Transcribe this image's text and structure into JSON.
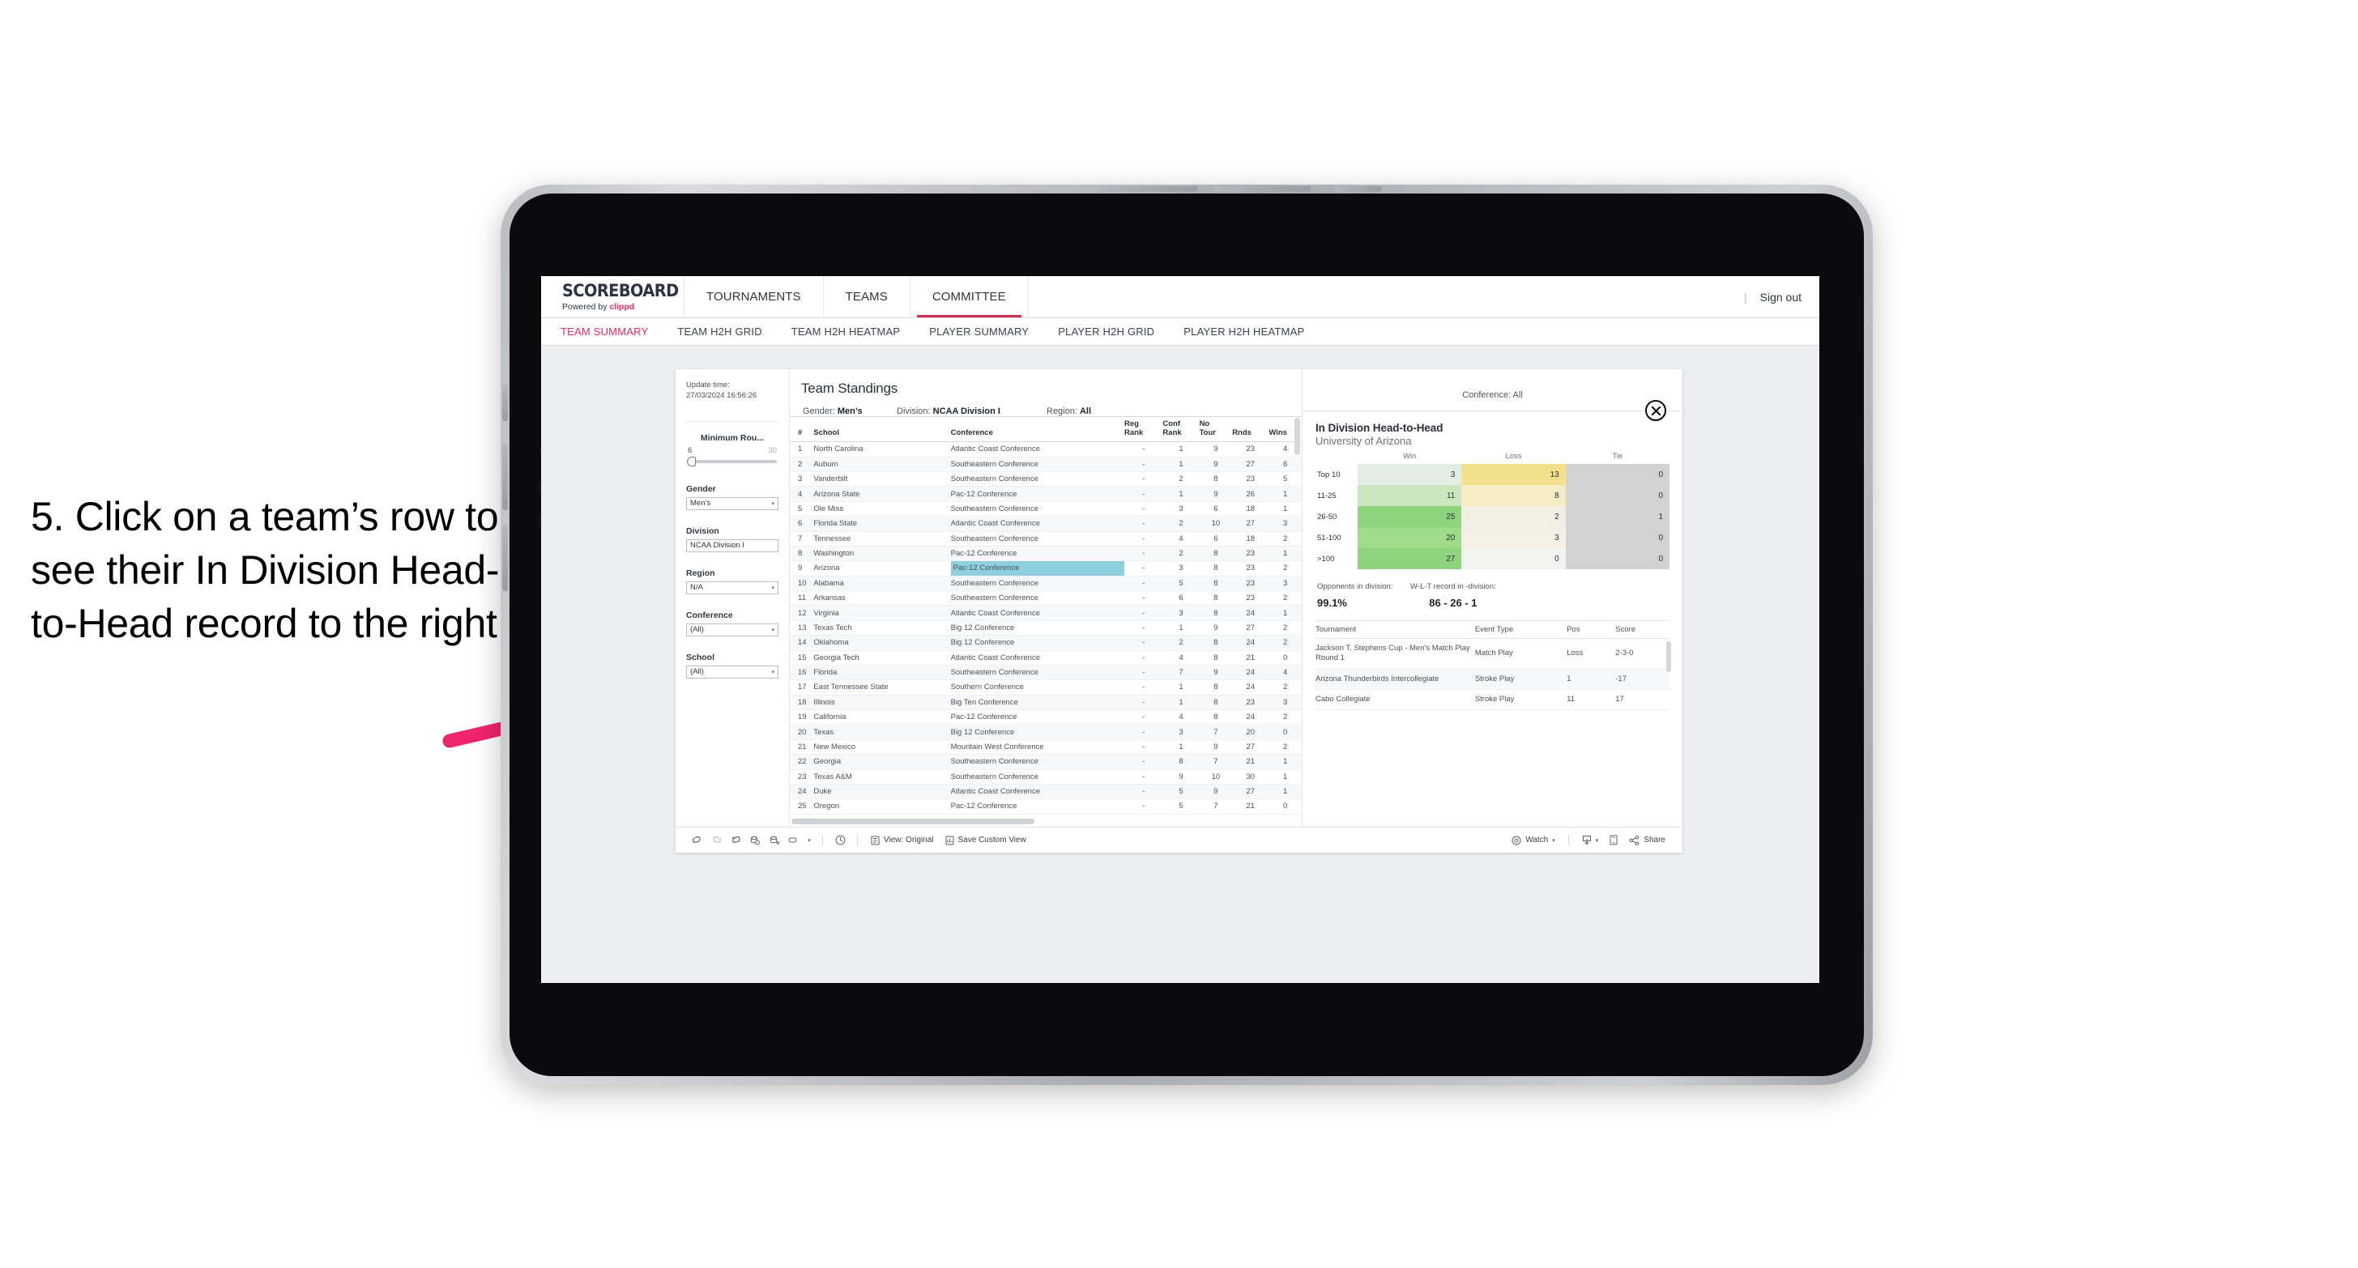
{
  "annotation": {
    "text": "5. Click on a team’s row to see their In Division Head-to-Head record to the right",
    "arrow_color": "#f0256b"
  },
  "topnav": {
    "logo_title": "SCOREBOARD",
    "logo_sub_prefix": "Powered by ",
    "logo_sub_brand": "clippd",
    "items": [
      {
        "label": "TOURNAMENTS",
        "active": false
      },
      {
        "label": "TEAMS",
        "active": false
      },
      {
        "label": "COMMITTEE",
        "active": true
      }
    ],
    "separator": "|",
    "signout": "Sign out"
  },
  "subtabs": [
    {
      "label": "TEAM SUMMARY",
      "active": true
    },
    {
      "label": "TEAM H2H GRID",
      "active": false
    },
    {
      "label": "TEAM H2H HEATMAP",
      "active": false
    },
    {
      "label": "PLAYER SUMMARY",
      "active": false
    },
    {
      "label": "PLAYER H2H GRID",
      "active": false
    },
    {
      "label": "PLAYER H2H HEATMAP",
      "active": false
    }
  ],
  "filters": {
    "update_label": "Update time:",
    "update_value": "27/03/2024 16:56:26",
    "slider": {
      "label": "Minimum Rou...",
      "min": "6",
      "max": "30"
    },
    "groups": [
      {
        "label": "Gender",
        "value": "Men’s",
        "caret": "▾"
      },
      {
        "label": "Division",
        "value": "NCAA Division I",
        "caret": ""
      },
      {
        "label": "Region",
        "value": "N/A",
        "caret": "▾"
      },
      {
        "label": "Conference",
        "value": "(All)",
        "caret": "▾"
      },
      {
        "label": "School",
        "value": "(All)",
        "caret": "▾"
      }
    ]
  },
  "standings": {
    "title": "Team Standings",
    "filters": [
      {
        "label": "Gender: ",
        "value": "Men’s"
      },
      {
        "label": "Division: ",
        "value": "NCAA Division I"
      },
      {
        "label": "Region: ",
        "value": "All"
      }
    ],
    "conference_filter": "Conference: All",
    "columns": [
      "#",
      "School",
      "Conference",
      "Reg Rank",
      "Conf Rank",
      "No Tour",
      "Rnds",
      "Wins"
    ],
    "columns_wrapped": [
      [
        "#",
        ""
      ],
      [
        "School",
        ""
      ],
      [
        "Conference",
        ""
      ],
      [
        "Reg",
        "Rank"
      ],
      [
        "Conf",
        "Rank"
      ],
      [
        "No",
        "Tour"
      ],
      [
        "",
        "Rnds"
      ],
      [
        "",
        "Wins"
      ]
    ],
    "rows": [
      {
        "rank": "1",
        "school": "North Carolina",
        "conference": "Atlantic Coast Conference",
        "reg": "-",
        "conf": "1",
        "notour": "9",
        "rnds": "23",
        "wins": "4",
        "highlight": false
      },
      {
        "rank": "2",
        "school": "Auburn",
        "conference": "Southeastern Conference",
        "reg": "-",
        "conf": "1",
        "notour": "9",
        "rnds": "27",
        "wins": "6",
        "highlight": false
      },
      {
        "rank": "3",
        "school": "Vanderbilt",
        "conference": "Southeastern Conference",
        "reg": "-",
        "conf": "2",
        "notour": "8",
        "rnds": "23",
        "wins": "5",
        "highlight": false
      },
      {
        "rank": "4",
        "school": "Arizona State",
        "conference": "Pac-12 Conference",
        "reg": "-",
        "conf": "1",
        "notour": "9",
        "rnds": "26",
        "wins": "1",
        "highlight": false
      },
      {
        "rank": "5",
        "school": "Ole Miss",
        "conference": "Southeastern Conference",
        "reg": "-",
        "conf": "3",
        "notour": "6",
        "rnds": "18",
        "wins": "1",
        "highlight": false
      },
      {
        "rank": "6",
        "school": "Florida State",
        "conference": "Atlantic Coast Conference",
        "reg": "-",
        "conf": "2",
        "notour": "10",
        "rnds": "27",
        "wins": "3",
        "highlight": false
      },
      {
        "rank": "7",
        "school": "Tennessee",
        "conference": "Southeastern Conference",
        "reg": "-",
        "conf": "4",
        "notour": "6",
        "rnds": "18",
        "wins": "2",
        "highlight": false
      },
      {
        "rank": "8",
        "school": "Washington",
        "conference": "Pac-12 Conference",
        "reg": "-",
        "conf": "2",
        "notour": "8",
        "rnds": "23",
        "wins": "1",
        "highlight": false
      },
      {
        "rank": "9",
        "school": "Arizona",
        "conference": "Pac-12 Conference",
        "reg": "-",
        "conf": "3",
        "notour": "8",
        "rnds": "23",
        "wins": "2",
        "highlight": true
      },
      {
        "rank": "10",
        "school": "Alabama",
        "conference": "Southeastern Conference",
        "reg": "-",
        "conf": "5",
        "notour": "8",
        "rnds": "23",
        "wins": "3",
        "highlight": false
      },
      {
        "rank": "11",
        "school": "Arkansas",
        "conference": "Southeastern Conference",
        "reg": "-",
        "conf": "6",
        "notour": "8",
        "rnds": "23",
        "wins": "2",
        "highlight": false
      },
      {
        "rank": "12",
        "school": "Virginia",
        "conference": "Atlantic Coast Conference",
        "reg": "-",
        "conf": "3",
        "notour": "8",
        "rnds": "24",
        "wins": "1",
        "highlight": false
      },
      {
        "rank": "13",
        "school": "Texas Tech",
        "conference": "Big 12 Conference",
        "reg": "-",
        "conf": "1",
        "notour": "9",
        "rnds": "27",
        "wins": "2",
        "highlight": false
      },
      {
        "rank": "14",
        "school": "Oklahoma",
        "conference": "Big 12 Conference",
        "reg": "-",
        "conf": "2",
        "notour": "8",
        "rnds": "24",
        "wins": "2",
        "highlight": false
      },
      {
        "rank": "15",
        "school": "Georgia Tech",
        "conference": "Atlantic Coast Conference",
        "reg": "-",
        "conf": "4",
        "notour": "8",
        "rnds": "21",
        "wins": "0",
        "highlight": false
      },
      {
        "rank": "16",
        "school": "Florida",
        "conference": "Southeastern Conference",
        "reg": "-",
        "conf": "7",
        "notour": "9",
        "rnds": "24",
        "wins": "4",
        "highlight": false
      },
      {
        "rank": "17",
        "school": "East Tennessee State",
        "conference": "Southern Conference",
        "reg": "-",
        "conf": "1",
        "notour": "8",
        "rnds": "24",
        "wins": "2",
        "highlight": false
      },
      {
        "rank": "18",
        "school": "Illinois",
        "conference": "Big Ten Conference",
        "reg": "-",
        "conf": "1",
        "notour": "8",
        "rnds": "23",
        "wins": "3",
        "highlight": false
      },
      {
        "rank": "19",
        "school": "California",
        "conference": "Pac-12 Conference",
        "reg": "-",
        "conf": "4",
        "notour": "8",
        "rnds": "24",
        "wins": "2",
        "highlight": false
      },
      {
        "rank": "20",
        "school": "Texas",
        "conference": "Big 12 Conference",
        "reg": "-",
        "conf": "3",
        "notour": "7",
        "rnds": "20",
        "wins": "0",
        "highlight": false
      },
      {
        "rank": "21",
        "school": "New Mexico",
        "conference": "Mountain West Conference",
        "reg": "-",
        "conf": "1",
        "notour": "9",
        "rnds": "27",
        "wins": "2",
        "highlight": false
      },
      {
        "rank": "22",
        "school": "Georgia",
        "conference": "Southeastern Conference",
        "reg": "-",
        "conf": "8",
        "notour": "7",
        "rnds": "21",
        "wins": "1",
        "highlight": false
      },
      {
        "rank": "23",
        "school": "Texas A&M",
        "conference": "Southeastern Conference",
        "reg": "-",
        "conf": "9",
        "notour": "10",
        "rnds": "30",
        "wins": "1",
        "highlight": false
      },
      {
        "rank": "24",
        "school": "Duke",
        "conference": "Atlantic Coast Conference",
        "reg": "-",
        "conf": "5",
        "notour": "9",
        "rnds": "27",
        "wins": "1",
        "highlight": false
      },
      {
        "rank": "25",
        "school": "Oregon",
        "conference": "Pac-12 Conference",
        "reg": "-",
        "conf": "5",
        "notour": "7",
        "rnds": "21",
        "wins": "0",
        "highlight": false
      }
    ]
  },
  "h2h": {
    "title": "In Division Head-to-Head",
    "subtitle": "University of Arizona",
    "close_icon": "close-icon",
    "chart_data": {
      "type": "heatmap",
      "title": "In Division Head-to-Head",
      "subtitle": "University of Arizona",
      "columns": [
        "Win",
        "Loss",
        "Tie"
      ],
      "rows": [
        "Top 10",
        "11-25",
        "26-50",
        "51-100",
        ">100"
      ],
      "values": [
        [
          3,
          13,
          0
        ],
        [
          11,
          8,
          0
        ],
        [
          25,
          2,
          1
        ],
        [
          20,
          3,
          0
        ],
        [
          27,
          0,
          0
        ]
      ],
      "cell_colors": [
        [
          "#e3eee2",
          "#f2e08c",
          "#d2d2d2"
        ],
        [
          "#cde6c2",
          "#f6ecc3",
          "#d2d2d2"
        ],
        [
          "#8ed47e",
          "#f2efe4",
          "#d2d2d2"
        ],
        [
          "#9edb8b",
          "#f4f0e6",
          "#d2d2d2"
        ],
        [
          "#8ed47e",
          "#f3f3f1",
          "#d2d2d2"
        ]
      ]
    },
    "stats": [
      {
        "label": "Opponents in division:",
        "value": "99.1%"
      },
      {
        "label": "W-L-T record in -division:",
        "value": "86 - 26 - 1"
      }
    ],
    "tournaments": {
      "columns": [
        "Tournament",
        "Event Type",
        "Pos",
        "Score"
      ],
      "rows": [
        {
          "name": "Jackson T. Stephens Cup - Men’s Match Play Round 1",
          "type": "Match Play",
          "pos": "Loss",
          "score": "2-3-0"
        },
        {
          "name": "Arizona Thunderbirds Intercollegiate",
          "type": "Stroke Play",
          "pos": "1",
          "score": "-17"
        },
        {
          "name": "Cabo Collegiate",
          "type": "Stroke Play",
          "pos": "11",
          "score": "17"
        }
      ]
    }
  },
  "toolbar": {
    "icons": [
      "undo-icon",
      "redo-icon",
      "revert-icon",
      "refresh-data-icon",
      "pause-updates-icon",
      "view-original-icon"
    ],
    "alert_icon": "alert-icon",
    "view_label": "View: Original",
    "view_icon": "view-icon",
    "save_label": "Save Custom View",
    "save_icon": "save-view-icon",
    "watch_label": "Watch",
    "watch_icon": "watch-icon",
    "download_icon": "download-icon",
    "device_icon": "device-icon",
    "share_label": "Share",
    "share_icon": "share-icon",
    "caret": "▾"
  }
}
